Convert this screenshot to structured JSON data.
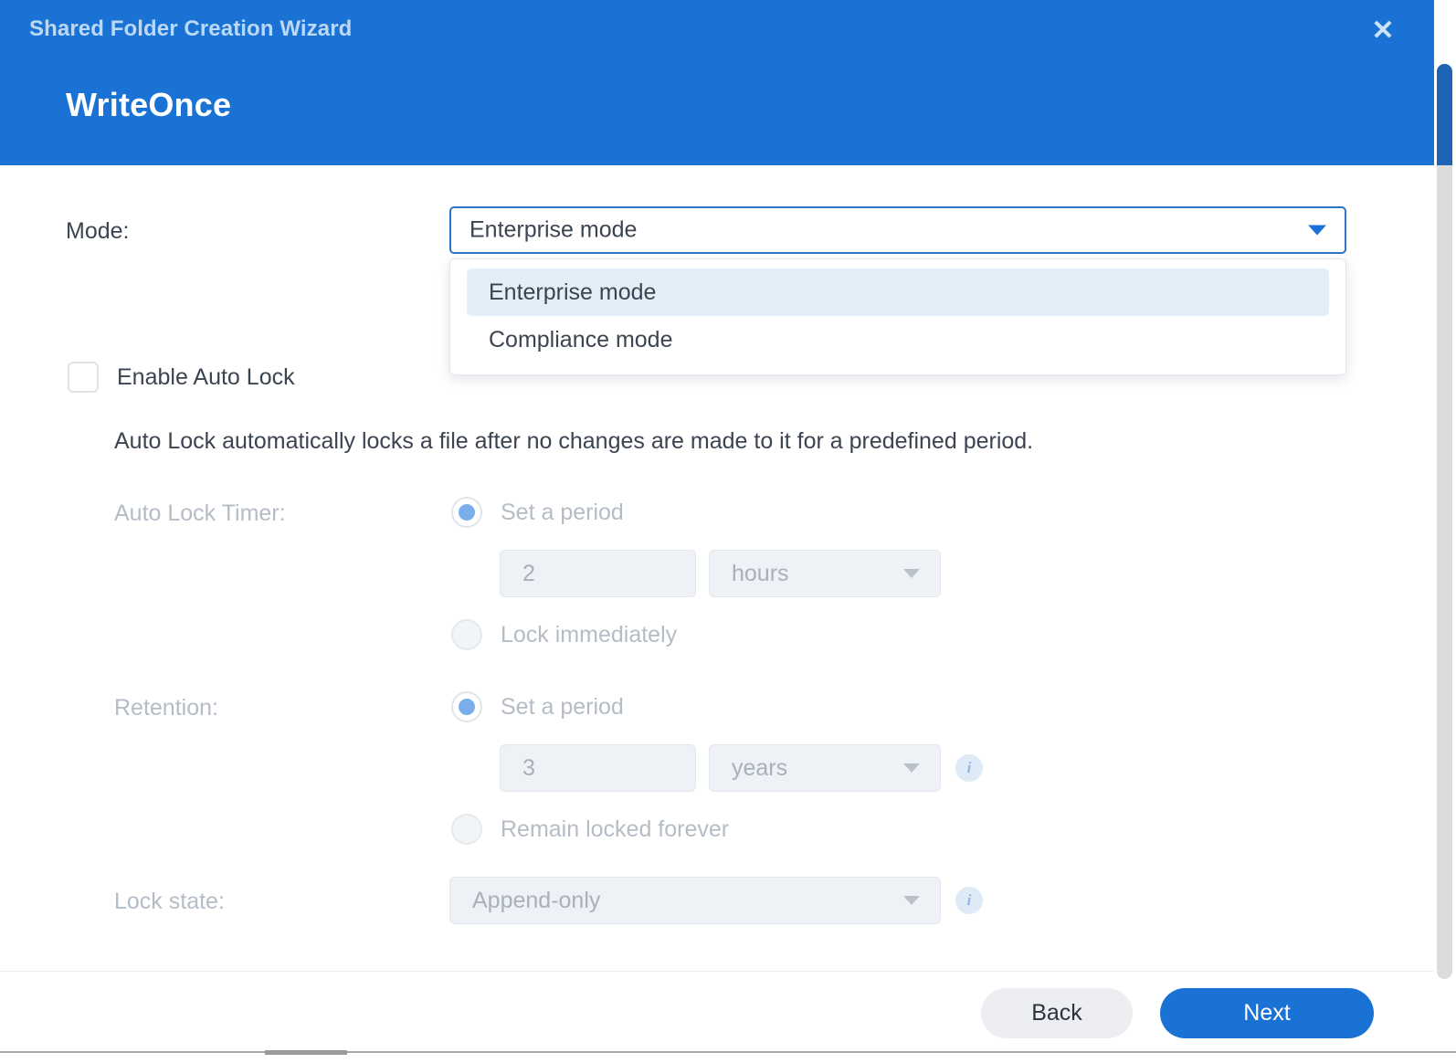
{
  "header": {
    "wizard_title": "Shared Folder Creation Wizard",
    "page_heading": "WriteOnce",
    "close_icon": "close-icon",
    "accent_color": "#1a73d4"
  },
  "mode": {
    "label": "Mode:",
    "selected_value": "Enterprise mode",
    "dropdown_open": true,
    "options": [
      {
        "label": "Enterprise mode",
        "selected": true
      },
      {
        "label": "Compliance mode",
        "selected": false
      }
    ],
    "arrow_icon": "chevron-down-icon"
  },
  "auto_lock": {
    "checkbox_label": "Enable Auto Lock",
    "checked": false,
    "description": "Auto Lock automatically locks a file after no changes are made to it for a predefined period."
  },
  "auto_lock_timer": {
    "label": "Auto Lock Timer:",
    "disabled": true,
    "options": [
      {
        "label": "Set a period",
        "selected": true
      },
      {
        "label": "Lock immediately",
        "selected": false
      }
    ],
    "amount_value": "2",
    "unit_value": "hours"
  },
  "retention": {
    "label": "Retention:",
    "disabled": true,
    "options": [
      {
        "label": "Set a period",
        "selected": true
      },
      {
        "label": "Remain locked forever",
        "selected": false
      }
    ],
    "amount_value": "3",
    "unit_value": "years",
    "info_icon": "info-icon"
  },
  "lock_state": {
    "label": "Lock state:",
    "disabled": true,
    "selected_value": "Append-only",
    "info_icon": "info-icon"
  },
  "footer": {
    "back_label": "Back",
    "next_label": "Next"
  }
}
